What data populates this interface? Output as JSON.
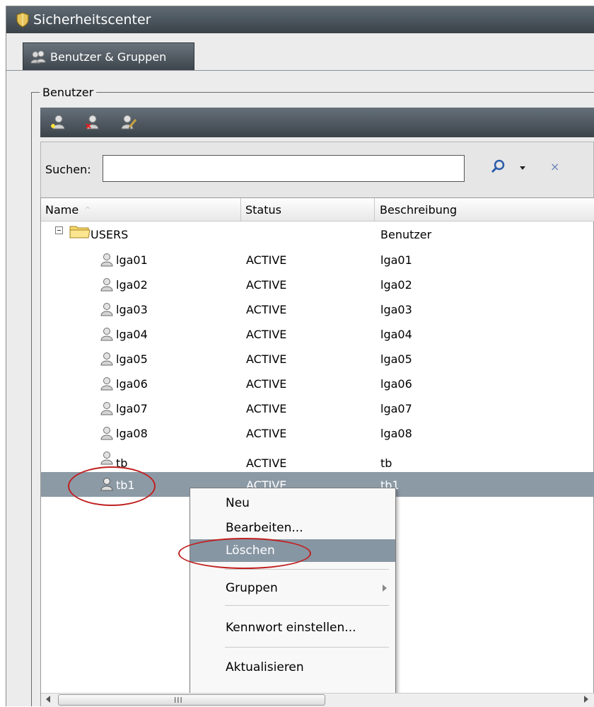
{
  "window": {
    "title": "Sicherheitscenter"
  },
  "tabs": [
    {
      "label": "Benutzer & Gruppen"
    }
  ],
  "group": {
    "legend": "Benutzer"
  },
  "toolbar": {
    "buttons": [
      "add-user-icon",
      "delete-user-icon",
      "edit-user-icon"
    ]
  },
  "search": {
    "label": "Suchen:",
    "value": "",
    "clear_glyph": "×"
  },
  "table": {
    "columns": [
      "Name",
      "Status",
      "Beschreibung"
    ],
    "sort_indicator": "^",
    "folder": {
      "name": "USERS",
      "status": "",
      "description": "Benutzer"
    },
    "rows": [
      {
        "name": "lga01",
        "status": "ACTIVE",
        "description": "lga01"
      },
      {
        "name": "lga02",
        "status": "ACTIVE",
        "description": "lga02"
      },
      {
        "name": "lga03",
        "status": "ACTIVE",
        "description": "lga03"
      },
      {
        "name": "lga04",
        "status": "ACTIVE",
        "description": "lga04"
      },
      {
        "name": "lga05",
        "status": "ACTIVE",
        "description": "lga05"
      },
      {
        "name": "lga06",
        "status": "ACTIVE",
        "description": "lga06"
      },
      {
        "name": "lga07",
        "status": "ACTIVE",
        "description": "lga07"
      },
      {
        "name": "lga08",
        "status": "ACTIVE",
        "description": "lga08"
      },
      {
        "name": "tb",
        "status": "ACTIVE",
        "description": "tb"
      },
      {
        "name": "tb1",
        "status": "ACTIVE",
        "description": "tb1",
        "selected": true
      }
    ]
  },
  "context_menu": {
    "items": [
      {
        "label": "Neu"
      },
      {
        "label": "Bearbeiten..."
      },
      {
        "label": "Löschen",
        "highlighted": true
      },
      {
        "label": "Gruppen",
        "submenu": true
      },
      {
        "label": "Kennwort einstellen..."
      },
      {
        "label": "Aktualisieren"
      }
    ]
  },
  "scrollbar": {
    "grip": "III"
  },
  "colors": {
    "selection": "#8c9aa6",
    "highlight_ring": "#c02020",
    "menu_highlight": "#8796a3"
  }
}
